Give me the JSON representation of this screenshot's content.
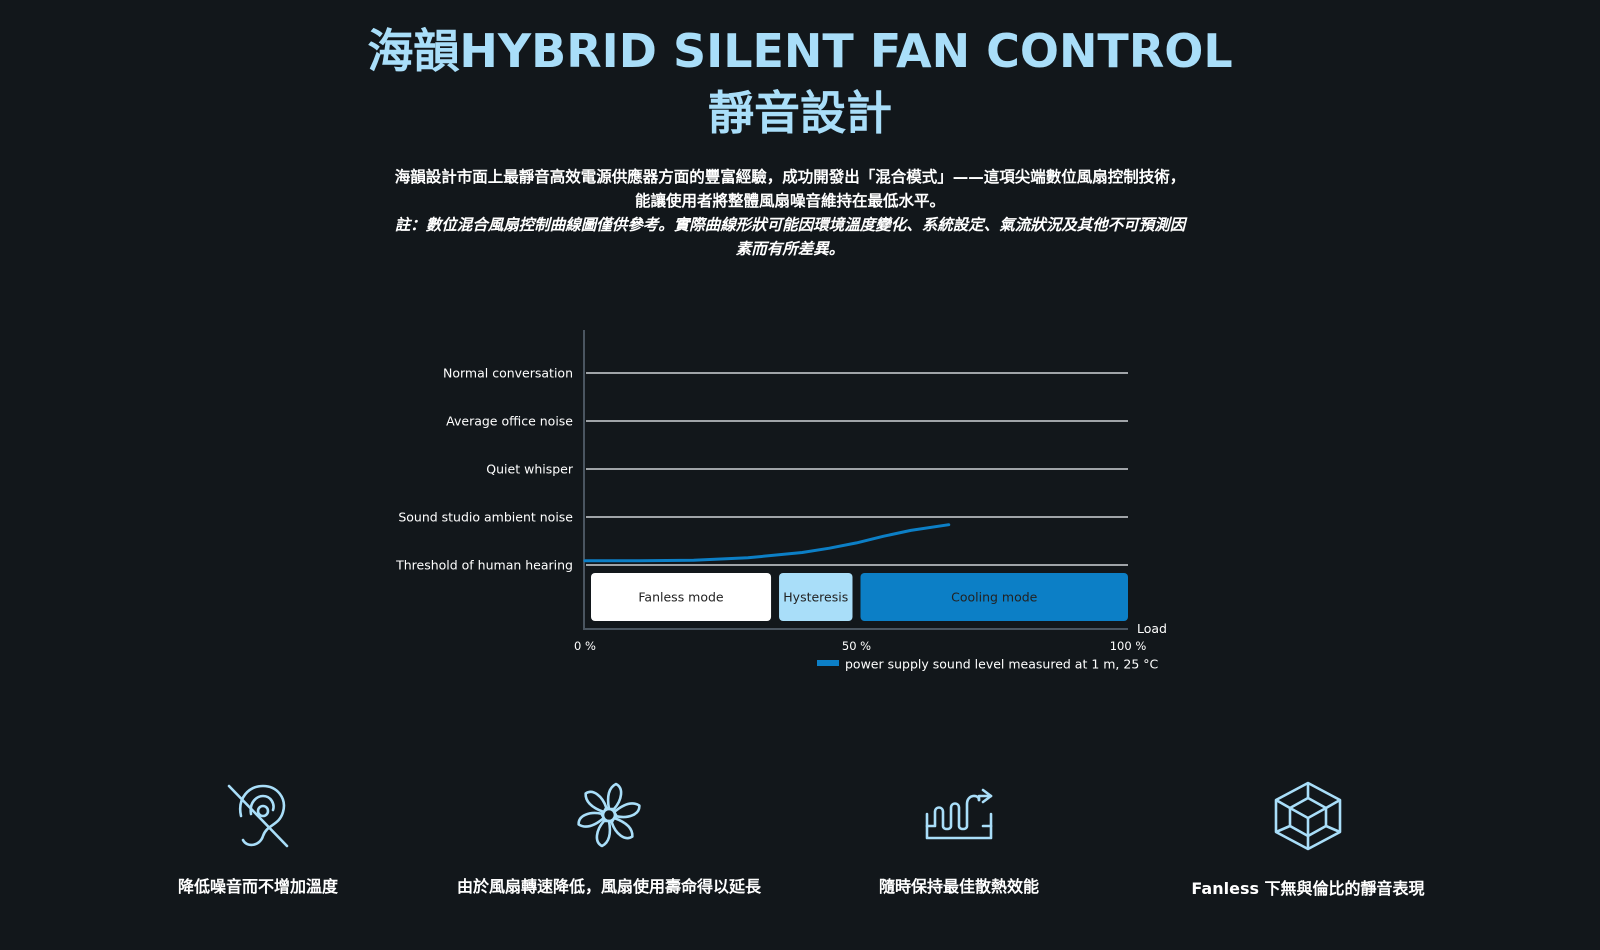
{
  "header": {
    "title_line1": "海韻HYBRID SILENT FAN CONTROL",
    "title_line2": "靜音設計",
    "description": "海韻設計市面上最靜音高效電源供應器方面的豐富經驗，成功開發出「混合模式」——這項尖端數位風扇控制技術，能讓使用者將整體風扇噪音維持在最低水平。",
    "note": "註：數位混合風扇控制曲線圖僅供參考。實際曲線形狀可能因環境溫度變化、系統設定、氣流狀況及其他不可預測因素而有所差異。"
  },
  "chart_data": {
    "type": "line",
    "xlabel": "Load",
    "x_ticks": [
      "0 %",
      "50 %",
      "100 %"
    ],
    "xlim": [
      0,
      100
    ],
    "y_levels": [
      "Threshold of human hearing",
      "Sound studio ambient noise",
      "Quiet whisper",
      "Average office noise",
      "Normal conversation"
    ],
    "ylim": [
      0,
      4
    ],
    "series": [
      {
        "name": "power supply sound level measured at 1 m, 25 °C",
        "color": "#0c7fc6",
        "x": [
          0,
          10,
          20,
          30,
          40,
          45,
          50,
          55,
          60,
          67
        ],
        "y": [
          0.09,
          0.09,
          0.1,
          0.15,
          0.26,
          0.35,
          0.46,
          0.6,
          0.72,
          0.84
        ]
      }
    ],
    "modes": [
      {
        "label": "Fanless mode",
        "start": 0,
        "end": 35,
        "fill": "#ffffff",
        "text_color": "#222222"
      },
      {
        "label": "Hysteresis",
        "start": 35,
        "end": 50,
        "fill": "#a9def9",
        "text_color": "#222222"
      },
      {
        "label": "Cooling mode",
        "start": 50,
        "end": 100,
        "fill": "#0c7fc6",
        "text_color": "#222222"
      }
    ],
    "grid": true,
    "legend_position": "bottom-right"
  },
  "features": [
    {
      "label": "降低噪音而不增加溫度",
      "icon": "no-hearing-icon"
    },
    {
      "label": "由於風扇轉速降低，風扇使用壽命得以延長",
      "icon": "fan-icon"
    },
    {
      "label": "隨時保持最佳散熱效能",
      "icon": "heat-dissipation-icon"
    },
    {
      "label": "Fanless 下無與倫比的靜音表現",
      "icon": "cube-icon"
    }
  ],
  "colors": {
    "background": "#12171b",
    "accent": "#a9def9",
    "series": "#0c7fc6"
  }
}
